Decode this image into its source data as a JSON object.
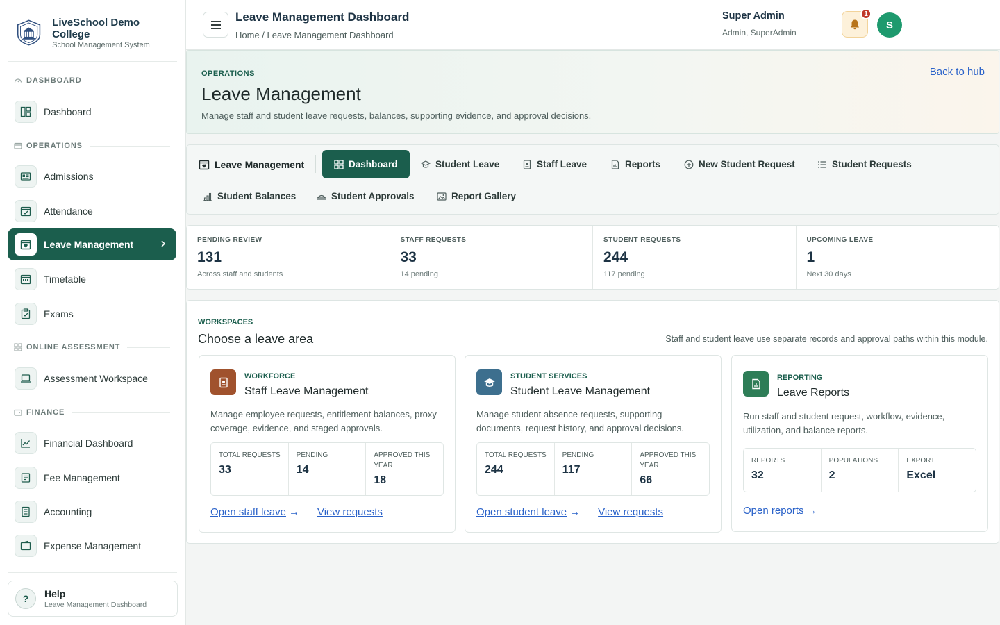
{
  "brand": {
    "name": "LiveSchool Demo College",
    "subtitle": "School Management System"
  },
  "sidebar": {
    "sections": {
      "dashboard": "DASHBOARD",
      "operations": "OPERATIONS",
      "online_assessment": "ONLINE ASSESSMENT",
      "finance": "FINANCE"
    },
    "items": {
      "dashboard": "Dashboard",
      "admissions": "Admissions",
      "attendance": "Attendance",
      "leave_management": "Leave Management",
      "timetable": "Timetable",
      "exams": "Exams",
      "assessment_workspace": "Assessment Workspace",
      "financial_dashboard": "Financial Dashboard",
      "fee_management": "Fee Management",
      "accounting": "Accounting",
      "expense_management": "Expense Management"
    },
    "help": {
      "title": "Help",
      "subtitle": "Leave Management Dashboard"
    }
  },
  "header": {
    "title": "Leave Management Dashboard",
    "breadcrumb": "Home / Leave Management Dashboard",
    "notification_count": "1",
    "user": {
      "initial": "S",
      "name": "Super Admin",
      "role": "Admin, SuperAdmin"
    }
  },
  "hero": {
    "kicker": "OPERATIONS",
    "title": "Leave Management",
    "description": "Manage staff and student leave requests, balances, supporting evidence, and approval decisions.",
    "back_link": "Back to hub"
  },
  "tabs": {
    "module": "Leave Management",
    "dashboard": "Dashboard",
    "student_leave": "Student Leave",
    "staff_leave": "Staff Leave",
    "reports": "Reports",
    "new_student_request": "New Student Request",
    "student_requests": "Student Requests",
    "student_balances": "Student Balances",
    "student_approvals": "Student Approvals",
    "report_gallery": "Report Gallery"
  },
  "stats": [
    {
      "label": "PENDING REVIEW",
      "value": "131",
      "sub": "Across staff and students"
    },
    {
      "label": "STAFF REQUESTS",
      "value": "33",
      "sub": "14 pending"
    },
    {
      "label": "STUDENT REQUESTS",
      "value": "244",
      "sub": "117 pending"
    },
    {
      "label": "UPCOMING LEAVE",
      "value": "1",
      "sub": "Next 30 days"
    }
  ],
  "workspaces": {
    "kicker": "WORKSPACES",
    "title": "Choose a leave area",
    "note": "Staff and student leave use separate records and approval paths within this module.",
    "cards": {
      "staff": {
        "kicker": "WORKFORCE",
        "title": "Staff Leave Management",
        "description": "Manage employee requests, entitlement balances, proxy coverage, evidence, and staged approvals.",
        "metrics": [
          {
            "label": "TOTAL REQUESTS",
            "value": "33"
          },
          {
            "label": "PENDING",
            "value": "14"
          },
          {
            "label": "APPROVED THIS YEAR",
            "value": "18"
          }
        ],
        "primary_link": "Open staff leave",
        "secondary_link": "View requests"
      },
      "student": {
        "kicker": "STUDENT SERVICES",
        "title": "Student Leave Management",
        "description": "Manage student absence requests, supporting documents, request history, and approval decisions.",
        "metrics": [
          {
            "label": "TOTAL REQUESTS",
            "value": "244"
          },
          {
            "label": "PENDING",
            "value": "117"
          },
          {
            "label": "APPROVED THIS YEAR",
            "value": "66"
          }
        ],
        "primary_link": "Open student leave",
        "secondary_link": "View requests"
      },
      "reports": {
        "kicker": "REPORTING",
        "title": "Leave Reports",
        "description": "Run staff and student request, workflow, evidence, utilization, and balance reports.",
        "metrics": [
          {
            "label": "REPORTS",
            "value": "32"
          },
          {
            "label": "POPULATIONS",
            "value": "2"
          },
          {
            "label": "EXPORT",
            "value": "Excel"
          }
        ],
        "primary_link": "Open reports"
      }
    }
  },
  "colors": {
    "accent": "#1b5e4d",
    "link": "#2a62c9",
    "staff_icon": "#a0522d",
    "student_icon": "#3d6f8e",
    "reports_icon": "#2e7d57",
    "notification": "#c0392b"
  },
  "icons": {
    "brand": "school-crest-icon",
    "bell": "bell-icon",
    "menu": "hamburger-icon"
  }
}
